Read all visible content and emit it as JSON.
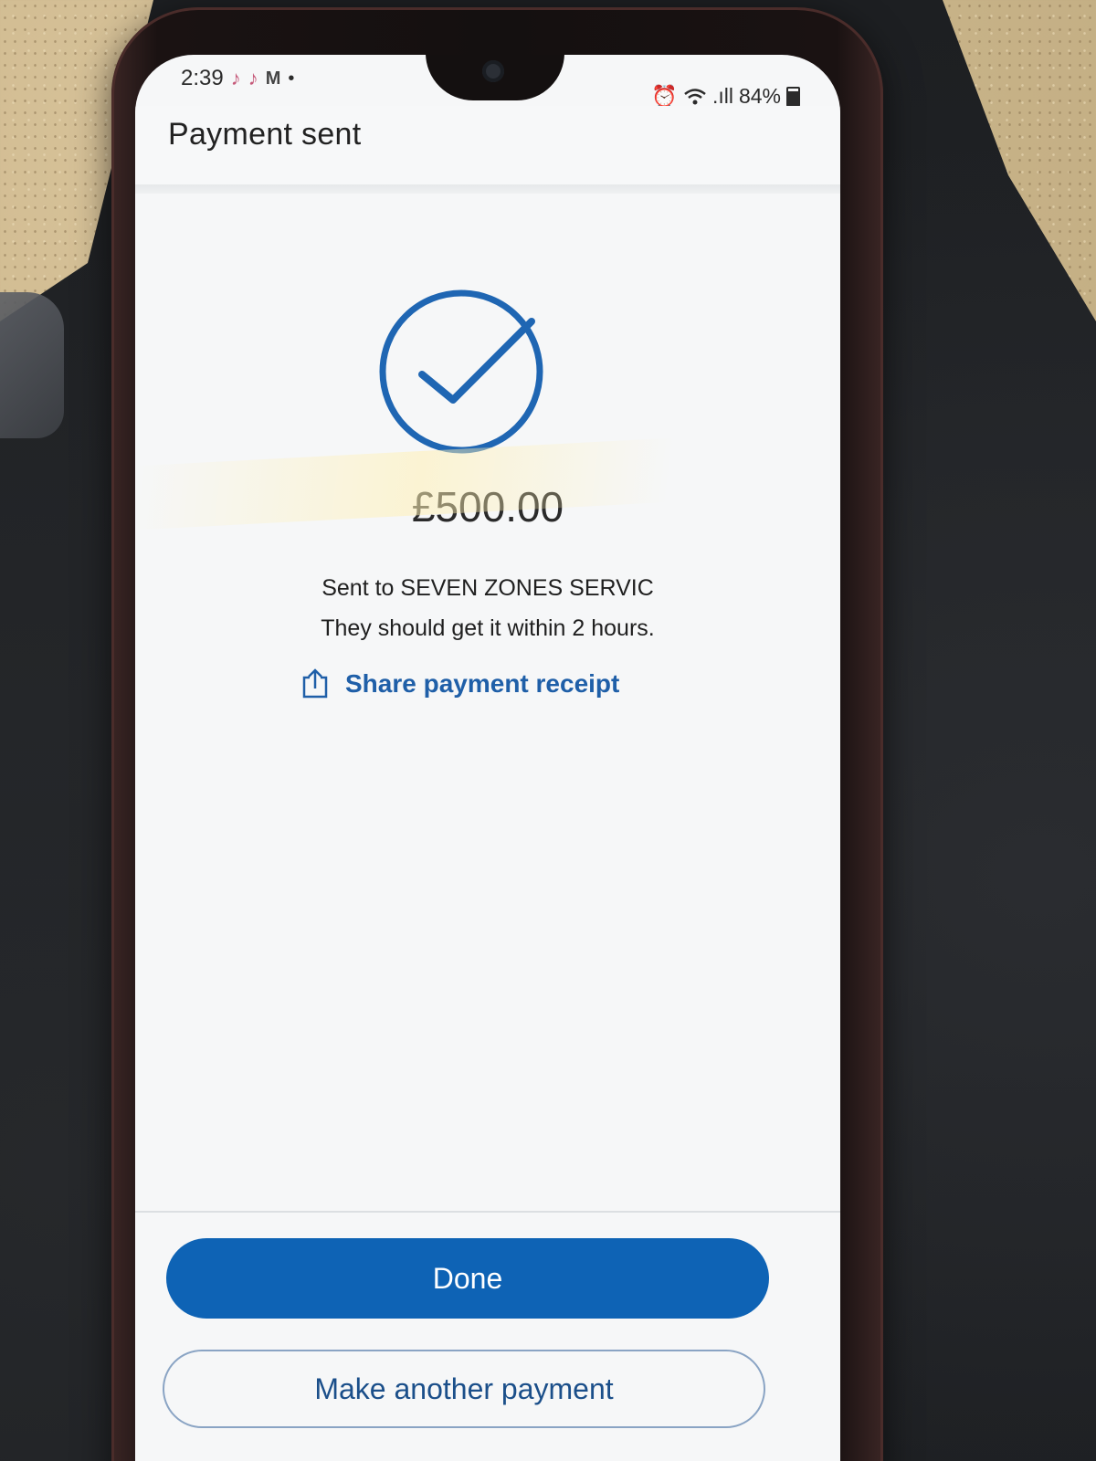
{
  "status_bar": {
    "time": "2:39",
    "notification_icons": [
      "tiktok-icon",
      "tiktok-icon",
      "gmail-icon"
    ],
    "signal_label": ".ıll",
    "battery": "84%"
  },
  "header": {
    "title": "Payment sent"
  },
  "confirmation": {
    "icon": "check-circle-icon",
    "amount": "£500.00",
    "recipient_line": "Sent to SEVEN ZONES SERVIC",
    "eta_line": "They should get it within 2 hours.",
    "share_label": "Share payment receipt"
  },
  "actions": {
    "done_label": "Done",
    "another_label": "Make another payment"
  },
  "colors": {
    "accent": "#0e63b5",
    "link": "#1f5fa8",
    "check": "#1f66b3"
  }
}
